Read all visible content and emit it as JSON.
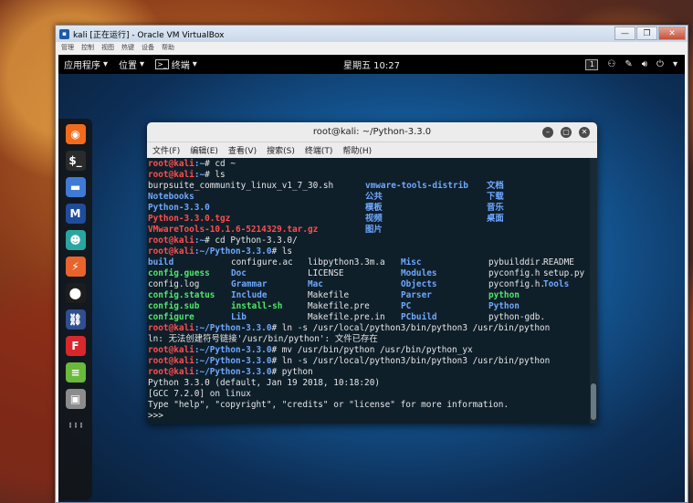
{
  "host": {
    "window_title": "kali [正在运行] - Oracle VM VirtualBox",
    "menu": [
      "管理",
      "控制",
      "视图",
      "热键",
      "设备",
      "帮助"
    ],
    "controls": {
      "minimize": "—",
      "restore": "❐",
      "close": "✕"
    }
  },
  "panel": {
    "apps_label": "应用程序",
    "places_label": "位置",
    "terminal_label": "终端",
    "clock": "星期五 10:27",
    "workspace": "1"
  },
  "dock": {
    "icons": [
      {
        "name": "firefox-icon",
        "glyph": "◉",
        "bg": "#f26b1d"
      },
      {
        "name": "terminal-icon",
        "glyph": "$_",
        "bg": "#2b2b2b"
      },
      {
        "name": "files-icon",
        "glyph": "▬",
        "bg": "#3f7ad6"
      },
      {
        "name": "metasploit-icon",
        "glyph": "M",
        "bg": "#1f4c9c"
      },
      {
        "name": "armitage-icon",
        "glyph": "☻",
        "bg": "#2aa6a0"
      },
      {
        "name": "burpsuite-icon",
        "glyph": "⚡",
        "bg": "#e8642c"
      },
      {
        "name": "maltego-icon",
        "glyph": "⬤",
        "bg": "#1d1d1d"
      },
      {
        "name": "kali-dragon-icon",
        "glyph": "⛓",
        "bg": "#2f4f8f"
      },
      {
        "name": "faraday-icon",
        "glyph": "F",
        "bg": "#d8282c"
      },
      {
        "name": "notes-icon",
        "glyph": "≡",
        "bg": "#6ab93a"
      },
      {
        "name": "system-icon",
        "glyph": "▣",
        "bg": "#8c8c8c"
      },
      {
        "name": "app-grid-icon",
        "glyph": "⋮⋮⋮",
        "bg": "transparent"
      }
    ]
  },
  "terminal": {
    "title": "root@kali: ~/Python-3.3.0",
    "menu": [
      "文件(F)",
      "编辑(E)",
      "查看(V)",
      "搜索(S)",
      "终端(T)",
      "帮助(H)"
    ],
    "colors": {
      "prompt": "#ff4d4d",
      "dir": "#6fa8ff",
      "exec": "#4ee86a",
      "archive": "#ff4d4d"
    },
    "lines": [
      {
        "type": "prompt",
        "user": "root@kali",
        "path": ":~",
        "sym": "# ",
        "cmd": "cd ~"
      },
      {
        "type": "prompt",
        "user": "root@kali",
        "path": ":~",
        "sym": "# ",
        "cmd": "ls"
      },
      {
        "type": "grid",
        "cols": [
          238,
          133,
          130
        ],
        "cells": [
          [
            "burpsuite_community_linux_v1_7_30.sh",
            ""
          ],
          [
            "vmware-tools-distrib",
            "blue"
          ],
          [
            "文档",
            "blue"
          ]
        ]
      },
      {
        "type": "grid",
        "cols": [
          238,
          133,
          130
        ],
        "cells": [
          [
            "Notebooks",
            "blue"
          ],
          [
            "公共",
            "blue"
          ],
          [
            "下载",
            "blue"
          ]
        ]
      },
      {
        "type": "grid",
        "cols": [
          238,
          133,
          130
        ],
        "cells": [
          [
            "Python-3.3.0",
            "blue"
          ],
          [
            "模板",
            "blue"
          ],
          [
            "音乐",
            "blue"
          ]
        ]
      },
      {
        "type": "grid",
        "cols": [
          238,
          133,
          130
        ],
        "cells": [
          [
            "Python-3.3.0.tgz",
            "red"
          ],
          [
            "视频",
            "blue"
          ],
          [
            "桌面",
            "blue"
          ]
        ]
      },
      {
        "type": "grid",
        "cols": [
          238,
          133,
          130
        ],
        "cells": [
          [
            "VMwareTools-10.1.6-5214329.tar.gz",
            "red"
          ],
          [
            "图片",
            "blue"
          ],
          [
            "",
            ""
          ]
        ]
      },
      {
        "type": "prompt",
        "user": "root@kali",
        "path": ":~",
        "sym": "# ",
        "cmd": "cd Python-3.3.0/"
      },
      {
        "type": "prompt",
        "user": "root@kali",
        "path": ":~/Python-3.3.0",
        "sym": "# ",
        "cmd": "ls"
      },
      {
        "type": "grid",
        "cols": [
          91,
          84,
          102,
          96,
          60
        ],
        "cells": [
          [
            "build",
            "blue"
          ],
          [
            "configure.ac",
            ""
          ],
          [
            "libpython3.3m.a",
            ""
          ],
          [
            "Misc",
            "blue"
          ],
          [
            "pybuilddir.txt",
            ""
          ],
          [
            "README",
            ""
          ]
        ]
      },
      {
        "type": "grid",
        "cols": [
          91,
          84,
          102,
          96,
          60
        ],
        "cells": [
          [
            "config.guess",
            "green"
          ],
          [
            "Doc",
            "blue"
          ],
          [
            "LICENSE",
            ""
          ],
          [
            "Modules",
            "blue"
          ],
          [
            "pyconfig.h",
            ""
          ],
          [
            "setup.py",
            ""
          ]
        ]
      },
      {
        "type": "grid",
        "cols": [
          91,
          84,
          102,
          96,
          60
        ],
        "cells": [
          [
            "config.log",
            ""
          ],
          [
            "Grammar",
            "blue"
          ],
          [
            "Mac",
            "blue"
          ],
          [
            "Objects",
            "blue"
          ],
          [
            "pyconfig.h.in",
            ""
          ],
          [
            "Tools",
            "blue"
          ]
        ]
      },
      {
        "type": "grid",
        "cols": [
          91,
          84,
          102,
          96,
          60
        ],
        "cells": [
          [
            "config.status",
            "green"
          ],
          [
            "Include",
            "blue"
          ],
          [
            "Makefile",
            ""
          ],
          [
            "Parser",
            "blue"
          ],
          [
            "python",
            "green"
          ],
          [
            "",
            ""
          ]
        ]
      },
      {
        "type": "grid",
        "cols": [
          91,
          84,
          102,
          96,
          60
        ],
        "cells": [
          [
            "config.sub",
            "green"
          ],
          [
            "install-sh",
            "green"
          ],
          [
            "Makefile.pre",
            ""
          ],
          [
            "PC",
            "blue"
          ],
          [
            "Python",
            "blue"
          ],
          [
            "",
            ""
          ]
        ]
      },
      {
        "type": "grid",
        "cols": [
          91,
          84,
          102,
          96,
          60
        ],
        "cells": [
          [
            "configure",
            "green"
          ],
          [
            "Lib",
            "blue"
          ],
          [
            "Makefile.pre.in",
            ""
          ],
          [
            "PCbuild",
            "blue"
          ],
          [
            "python-gdb.py",
            ""
          ],
          [
            "",
            ""
          ]
        ]
      },
      {
        "type": "prompt",
        "user": "root@kali",
        "path": ":~/Python-3.3.0",
        "sym": "# ",
        "cmd": "ln -s /usr/local/python3/bin/python3 /usr/bin/python"
      },
      {
        "type": "text",
        "text": "ln: 无法创建符号链接'/usr/bin/python': 文件已存在"
      },
      {
        "type": "prompt",
        "user": "root@kali",
        "path": ":~/Python-3.3.0",
        "sym": "# ",
        "cmd": "mv /usr/bin/python /usr/bin/python_yx"
      },
      {
        "type": "prompt",
        "user": "root@kali",
        "path": ":~/Python-3.3.0",
        "sym": "# ",
        "cmd": "ln -s /usr/local/python3/bin/python3 /usr/bin/python"
      },
      {
        "type": "prompt",
        "user": "root@kali",
        "path": ":~/Python-3.3.0",
        "sym": "# ",
        "cmd": "python"
      },
      {
        "type": "text",
        "text": "Python 3.3.0 (default, Jan 19 2018, 10:18:20)"
      },
      {
        "type": "text",
        "text": "[GCC 7.2.0] on linux"
      },
      {
        "type": "text",
        "text": "Type \"help\", \"copyright\", \"credits\" or \"license\" for more information."
      },
      {
        "type": "text",
        "text": ">>> "
      }
    ]
  }
}
